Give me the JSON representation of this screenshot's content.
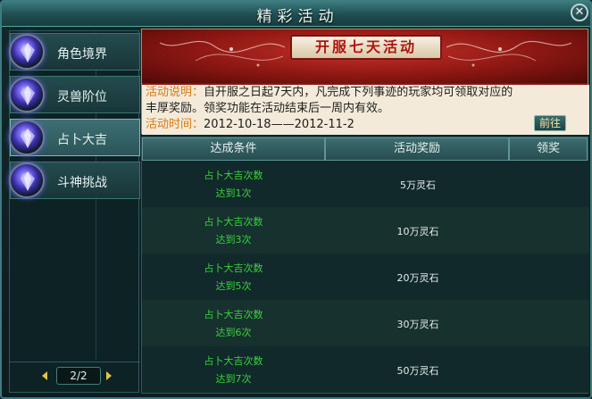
{
  "window": {
    "title": "精彩活动",
    "close_glyph": "✕"
  },
  "sidebar": {
    "items": [
      {
        "label": "角色境界",
        "icon": "crystal-orb-icon"
      },
      {
        "label": "灵兽阶位",
        "icon": "crystal-orb-icon"
      },
      {
        "label": "占卜大吉",
        "icon": "crystal-orb-icon",
        "active": true
      },
      {
        "label": "斗神挑战",
        "icon": "crystal-orb-icon"
      }
    ],
    "pager": {
      "text": "2/2"
    }
  },
  "banner": {
    "title": "开服七天活动",
    "desc_key": "活动说明：",
    "desc_text_1": "自开服之日起7天内，凡完成下列事迹的玩家均可领取对应的",
    "desc_text_2": "丰厚奖励。领奖功能在活动结束后一周内有效。",
    "time_key": "活动时间：",
    "time_text": "2012-10-18——2012-11-2",
    "goto_label": "前往"
  },
  "table": {
    "headers": [
      "达成条件",
      "活动奖励",
      "领奖"
    ],
    "rows": [
      {
        "cond1": "占卜大吉次数",
        "cond2": "达到1次",
        "reward": "5万灵石"
      },
      {
        "cond1": "占卜大吉次数",
        "cond2": "达到3次",
        "reward": "10万灵石"
      },
      {
        "cond1": "占卜大吉次数",
        "cond2": "达到5次",
        "reward": "20万灵石"
      },
      {
        "cond1": "占卜大吉次数",
        "cond2": "达到6次",
        "reward": "30万灵石"
      },
      {
        "cond1": "占卜大吉次数",
        "cond2": "达到7次",
        "reward": "50万灵石"
      }
    ]
  },
  "colors": {
    "condition_text": "#36d43a",
    "accent_orange": "#d97a12",
    "banner_red": "#a11c18"
  }
}
